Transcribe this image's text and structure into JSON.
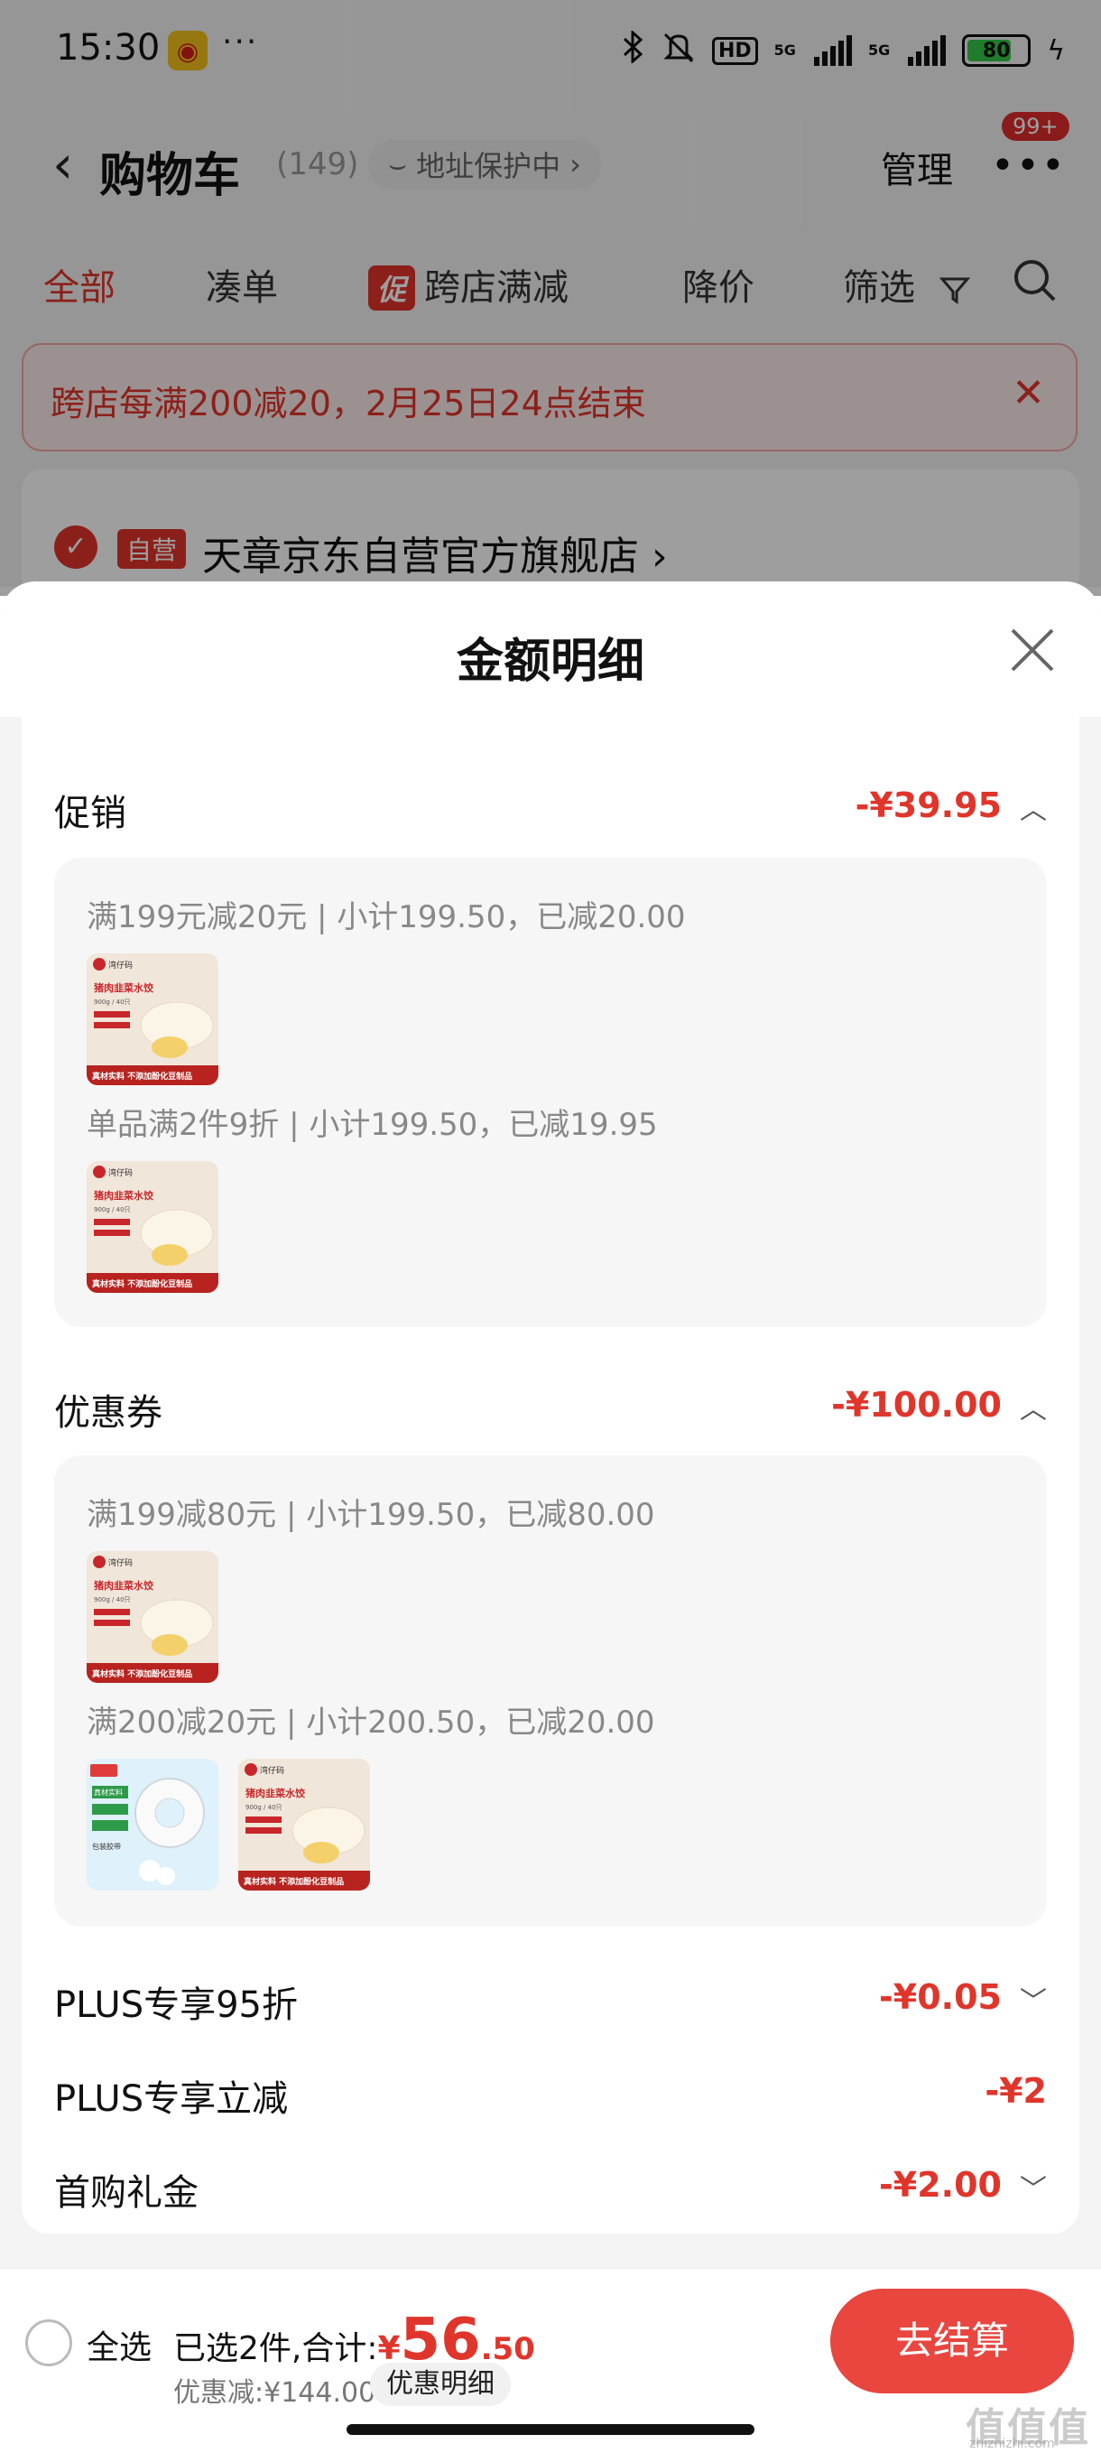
{
  "status_bar": {
    "time": "15:30",
    "more": "···",
    "battery": "80",
    "net1": "5G",
    "net2": "5G",
    "hd": "HD"
  },
  "header": {
    "back": "‹",
    "title": "购物车",
    "count": "(149)",
    "address": "地址保护中",
    "manage": "管理",
    "more": "•••",
    "badge": "99+"
  },
  "tabs": [
    {
      "label": "全部"
    },
    {
      "label": "凑单"
    },
    {
      "label": "跨店满减",
      "tag": "促"
    },
    {
      "label": "降价"
    },
    {
      "label": "筛选"
    }
  ],
  "notice": {
    "text": "跨店每满200减20，2月25日24点结束",
    "close": "✕"
  },
  "store": {
    "self_tag": "自营",
    "name": "天章京东自营官方旗舰店 ›"
  },
  "sheet": {
    "title": "金额明细",
    "sections": [
      {
        "label": "促销",
        "amount": "-¥39.95",
        "expanded": true,
        "rules": [
          {
            "text": "满199元减20元 | 小计199.50，已减20.00"
          },
          {
            "text": "单品满2件9折 | 小计199.50，已减19.95"
          }
        ]
      },
      {
        "label": "优惠券",
        "amount": "-¥100.00",
        "expanded": true,
        "rules": [
          {
            "text": "满199减80元 | 小计199.50，已减80.00"
          },
          {
            "text": "满200减20元 | 小计200.50，已减20.00"
          }
        ]
      }
    ],
    "plus95": {
      "label": "PLUS专享95折",
      "amount": "-¥0.05"
    },
    "plus_cut": {
      "label": "PLUS专享立减",
      "amount": "-¥2"
    },
    "first_gift": {
      "label": "首购礼金",
      "amount": "-¥2.00"
    },
    "dumpling_product": {
      "name_line": "猪肉韭菜水饺",
      "spec_line": "900g / 40只",
      "banner": "真材实料 不添加酚化豆制品",
      "brand": "湾仔码"
    },
    "tape_product": {
      "name_line": "包装胶带",
      "tag": "真材实料"
    }
  },
  "bottom": {
    "select_all": "全选",
    "selected": "已选2件,合计:",
    "currency": "¥",
    "total_int": "56",
    "total_dec": ".50",
    "discount": "优惠减:¥144.00",
    "detail": "优惠明细",
    "checkout": "去结算",
    "watermark": "值值值",
    "watermark_url": "zhizhizhi.com"
  },
  "colors": {
    "accent": "#e0352b",
    "checkout": "#e8463f"
  }
}
